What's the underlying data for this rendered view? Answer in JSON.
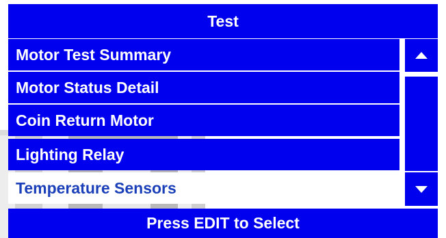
{
  "header": {
    "title": "Test"
  },
  "menu": {
    "items": [
      {
        "label": "Motor Test Summary",
        "selected": false
      },
      {
        "label": "Motor Status Detail",
        "selected": false
      },
      {
        "label": "Coin Return Motor",
        "selected": false
      },
      {
        "label": "Lighting Relay",
        "selected": false
      },
      {
        "label": "Temperature Sensors",
        "selected": true
      }
    ]
  },
  "scrollbar": {
    "up_icon": "triangle-up-icon",
    "down_icon": "triangle-down-icon"
  },
  "footer": {
    "hint": "Press EDIT to Select"
  },
  "colors": {
    "panel": "#0000ee",
    "text": "#ffffff",
    "selected_bg": "#ffffff",
    "selected_text": "#1a3fb8"
  }
}
